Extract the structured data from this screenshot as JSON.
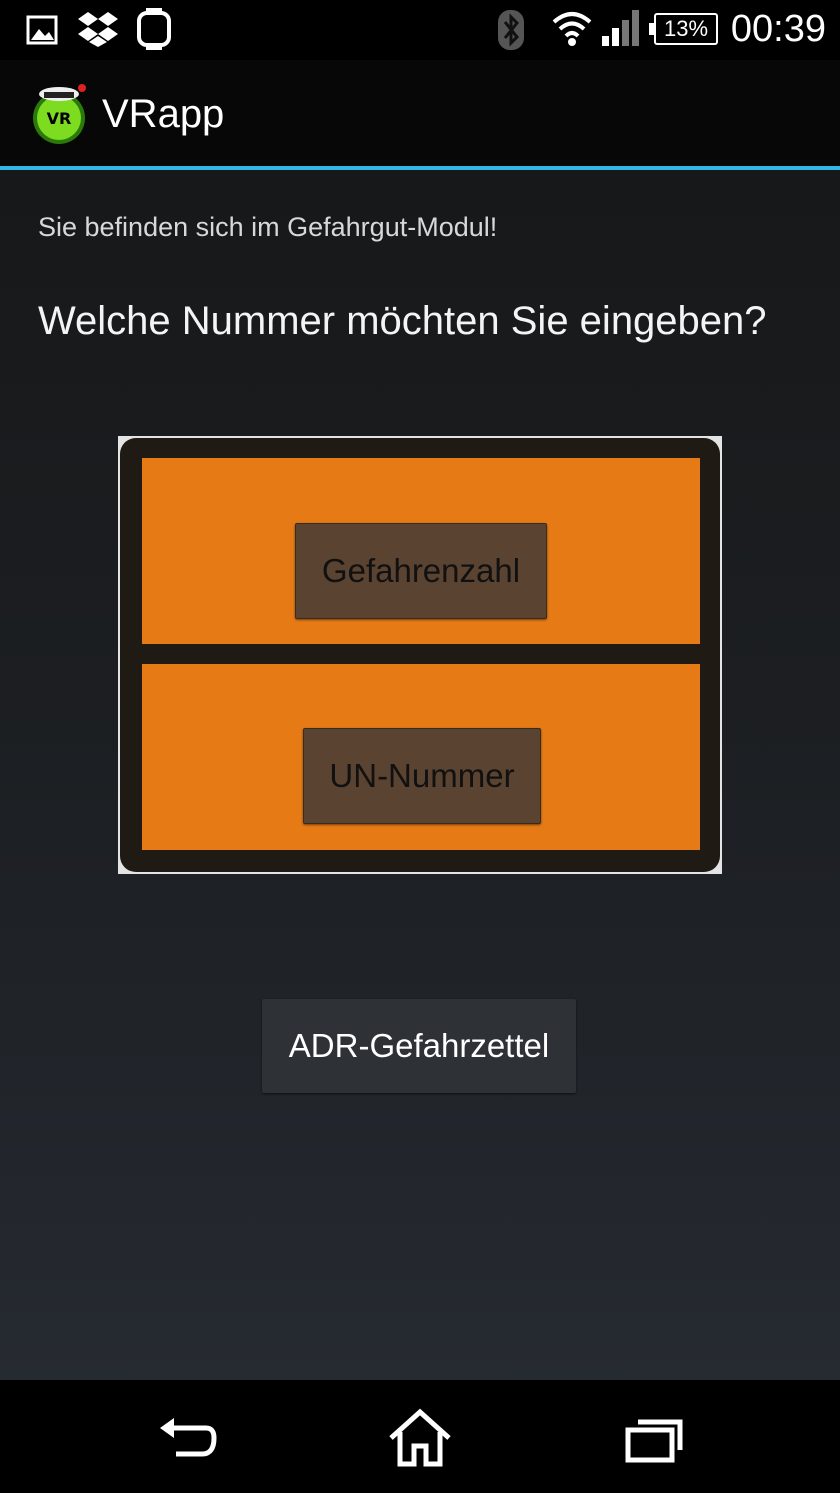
{
  "status_bar": {
    "time": "00:39",
    "battery": "13%",
    "icons": [
      "image-icon",
      "dropbox-icon",
      "watch-icon",
      "bluetooth-icon",
      "wifi-icon",
      "signal-icon",
      "battery-icon"
    ]
  },
  "action_bar": {
    "title": "VRapp",
    "app_icon": "vrapp-logo-icon"
  },
  "main": {
    "intro": "Sie befinden sich im Gefahrgut-Modul!",
    "question": "Welche Nummer möchten Sie eingeben?",
    "hazard_sign": {
      "top_button": "Gefahrenzahl",
      "bottom_button": "UN-Nummer"
    },
    "adr_button": "ADR-Gefahrzettel"
  },
  "nav_bar": {
    "icons": [
      "back-icon",
      "home-icon",
      "recent-apps-icon"
    ]
  },
  "colors": {
    "accent": "#33b5e5",
    "sign_orange": "#e67b15",
    "sign_button": "#5a4330"
  }
}
